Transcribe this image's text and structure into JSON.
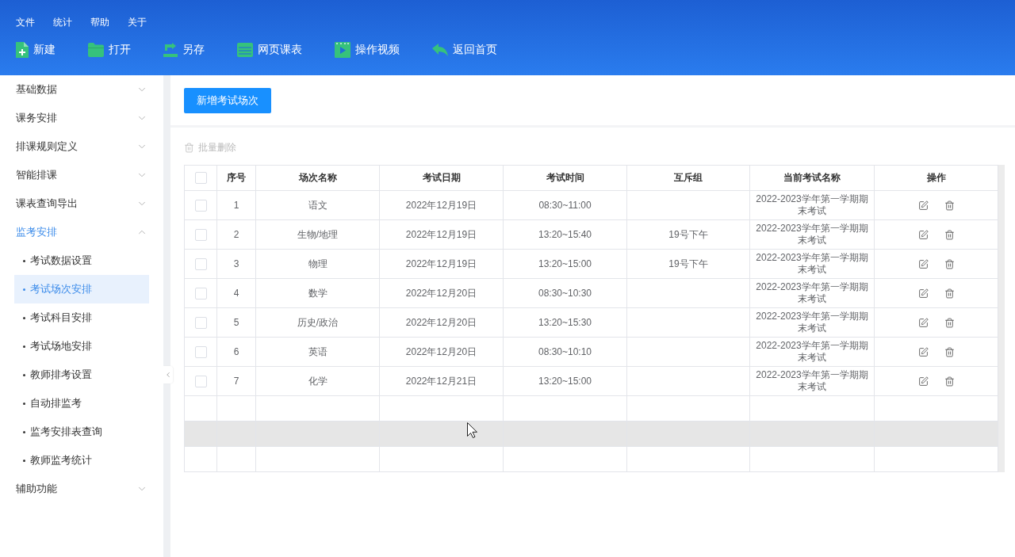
{
  "menu_bar": [
    "文件",
    "统计",
    "帮助",
    "关于"
  ],
  "toolbar": [
    {
      "label": "新建"
    },
    {
      "label": "打开"
    },
    {
      "label": "另存"
    },
    {
      "label": "网页课表"
    },
    {
      "label": "操作视频"
    },
    {
      "label": "返回首页"
    }
  ],
  "sidebar": {
    "items": [
      {
        "label": "基础数据",
        "expanded": false,
        "selected": false
      },
      {
        "label": "课务安排",
        "expanded": false,
        "selected": false
      },
      {
        "label": "排课规则定义",
        "expanded": false,
        "selected": false
      },
      {
        "label": "智能排课",
        "expanded": false,
        "selected": false
      },
      {
        "label": "课表查询导出",
        "expanded": false,
        "selected": false
      },
      {
        "label": "监考安排",
        "expanded": true,
        "selected": true,
        "children": [
          {
            "label": "考试数据设置",
            "selected": false
          },
          {
            "label": "考试场次安排",
            "selected": true
          },
          {
            "label": "考试科目安排",
            "selected": false
          },
          {
            "label": "考试场地安排",
            "selected": false
          },
          {
            "label": "教师排考设置",
            "selected": false
          },
          {
            "label": "自动排监考",
            "selected": false
          },
          {
            "label": "监考安排表查询",
            "selected": false
          },
          {
            "label": "教师监考统计",
            "selected": false
          }
        ]
      },
      {
        "label": "辅助功能",
        "expanded": false,
        "selected": false
      }
    ]
  },
  "add_button": {
    "label": "新增考试场次"
  },
  "batch_delete": {
    "label": "批量删除",
    "disabled": true
  },
  "table": {
    "select_all_checked": false,
    "columns": [
      "序号",
      "场次名称",
      "考试日期",
      "考试时间",
      "互斥组",
      "当前考试名称",
      "操作"
    ],
    "rows": [
      {
        "checked": false,
        "seq": "1",
        "name": "语文",
        "date": "2022年12月19日",
        "time": "08:30~11:00",
        "exam": "2022-2023学年第一学期期末考试"
      },
      {
        "checked": false,
        "seq": "2",
        "name": "生物/地理",
        "date": "2022年12月19日",
        "time": "13:20~15:40",
        "group": "19号下午",
        "exam": "2022-2023学年第一学期期末考试"
      },
      {
        "checked": false,
        "seq": "3",
        "name": "物理",
        "date": "2022年12月19日",
        "time": "13:20~15:00",
        "group": "19号下午",
        "exam": "2022-2023学年第一学期期末考试"
      },
      {
        "checked": false,
        "seq": "4",
        "name": "数学",
        "date": "2022年12月20日",
        "time": "08:30~10:30",
        "exam": "2022-2023学年第一学期期末考试"
      },
      {
        "checked": false,
        "seq": "5",
        "name": "历史/政治",
        "date": "2022年12月20日",
        "time": "13:20~15:30",
        "exam": "2022-2023学年第一学期期末考试"
      },
      {
        "checked": false,
        "seq": "6",
        "name": "英语",
        "date": "2022年12月20日",
        "time": "08:30~10:10",
        "exam": "2022-2023学年第一学期期末考试"
      },
      {
        "checked": false,
        "seq": "7",
        "name": "化学",
        "date": "2022年12月21日",
        "time": "13:20~15:00",
        "exam": "2022-2023学年第一学期期末考试"
      }
    ],
    "blank_rows": [
      {
        "hovered": false
      },
      {
        "hovered": true
      },
      {
        "hovered": false
      }
    ]
  }
}
